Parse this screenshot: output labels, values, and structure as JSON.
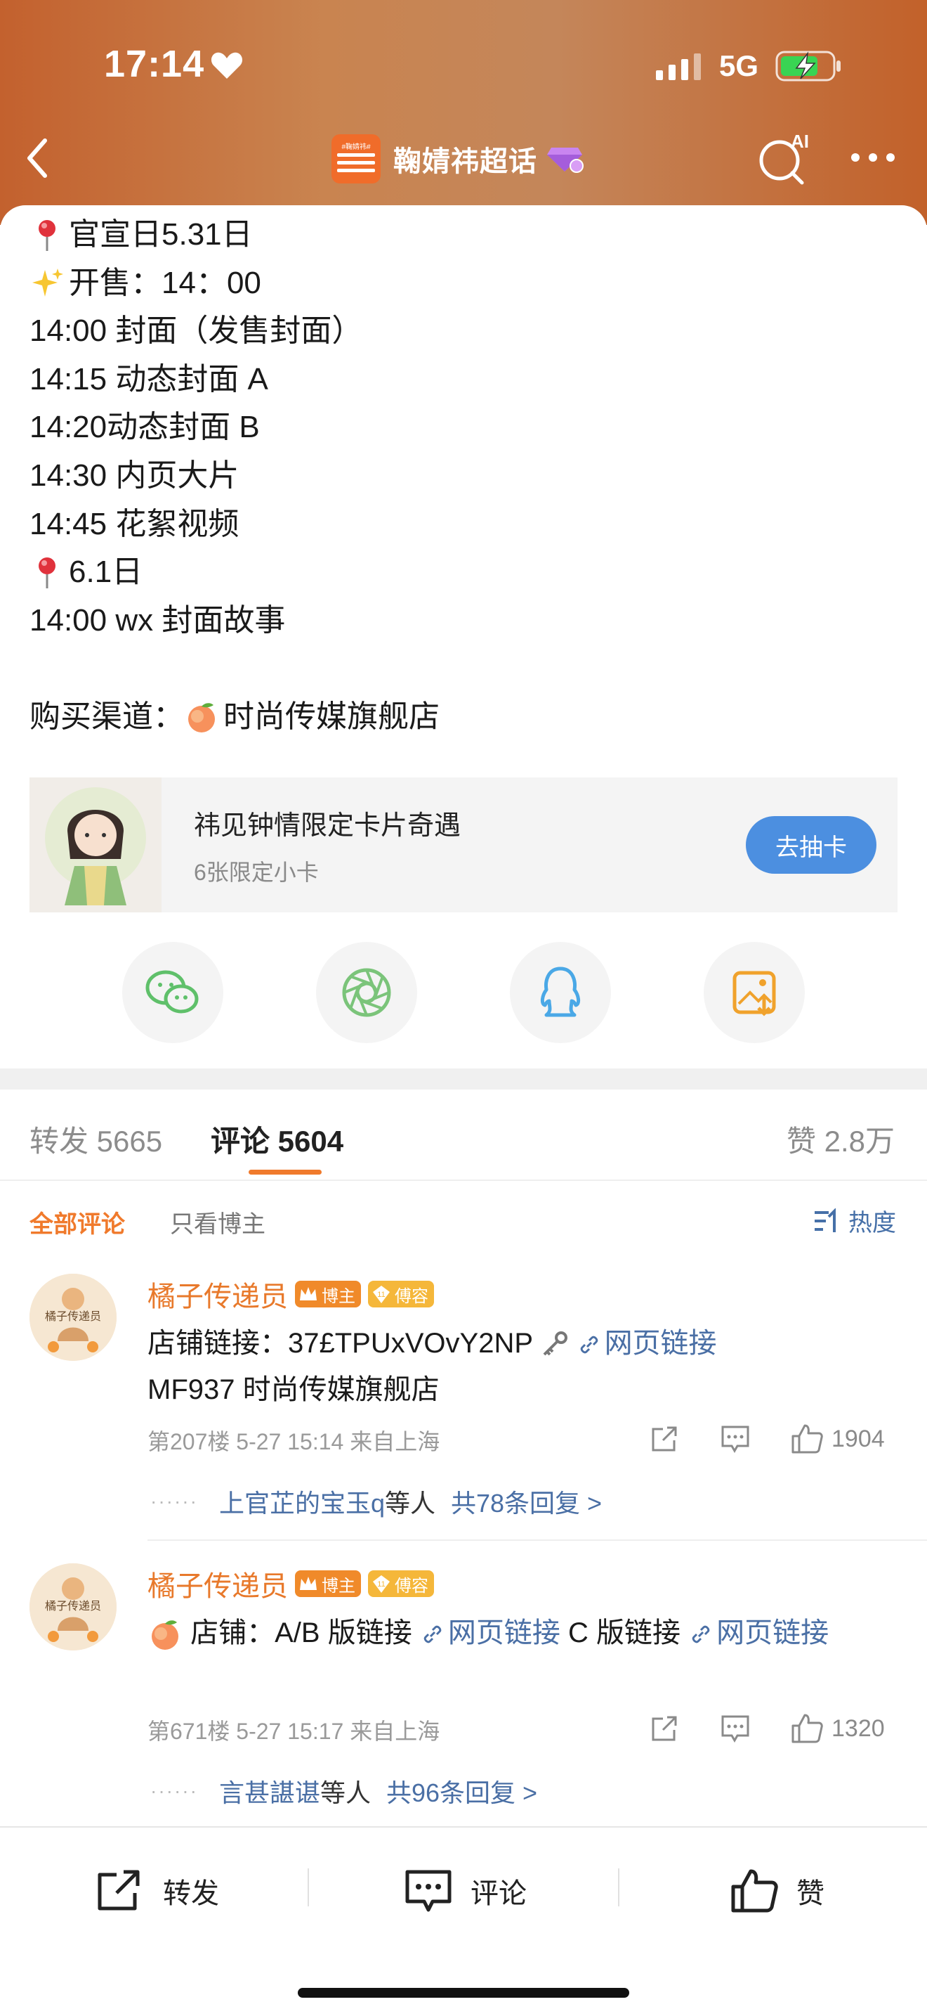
{
  "status": {
    "time": "17:14",
    "network": "5G"
  },
  "nav": {
    "title": "鞠婧祎超话",
    "logo_text": "#鞠婧祎#"
  },
  "post": {
    "lines": [
      {
        "emoji": "pin-icon",
        "text": "官宣日5.31日"
      },
      {
        "emoji": "sparkles-icon",
        "text": "开售：14：00"
      },
      {
        "emoji": "",
        "text": "14:00 封面（发售封面）"
      },
      {
        "emoji": "",
        "text": "14:15 动态封面 A"
      },
      {
        "emoji": "",
        "text": "14:20动态封面 B"
      },
      {
        "emoji": "",
        "text": "14:30 内页大片"
      },
      {
        "emoji": "",
        "text": "14:45 花絮视频"
      },
      {
        "emoji": "pin-icon",
        "text": "6.1日"
      },
      {
        "emoji": "",
        "text": "14:00 wx 封面故事"
      }
    ],
    "channel_label": "购买渠道：",
    "channel_name": "时尚传媒旗舰店"
  },
  "card": {
    "title": "祎见钟情限定卡片奇遇",
    "subtitle": "6张限定小卡",
    "button": "去抽卡"
  },
  "share": [
    "wechat-icon",
    "moments-icon",
    "qq-icon",
    "save-image-icon"
  ],
  "tabs": {
    "repost": "转发 5665",
    "comment": "评论 5604",
    "like": "赞 2.8万"
  },
  "filters": {
    "all": "全部评论",
    "host_only": "只看博主",
    "sort": "热度"
  },
  "comments": [
    {
      "name": "橘子传递员",
      "badge_host": "博主",
      "badge_honor": "傅容",
      "text_a": "店铺链接：37£TPUxVOvY2NP",
      "link": "网页链接",
      "text_b": "MF937 时尚传媒旗舰店",
      "meta": "第207楼 5-27 15:14 来自上海",
      "likes": "1904",
      "reply_user": "上官芷的宝玉q",
      "reply_mid": "等人",
      "reply_count": "共78条回复 >"
    },
    {
      "name": "橘子传递员",
      "badge_host": "博主",
      "badge_honor": "傅容",
      "text_a": "店铺：A/B 版链接",
      "link": "网页链接",
      "text_b": "C 版链接",
      "link2": "网页链接",
      "meta": "第671楼 5-27 15:17 来自上海",
      "likes": "1320",
      "reply_user": "言甚諶谌",
      "reply_mid": "等人",
      "reply_count": "共96条回复 >"
    }
  ],
  "bottom": {
    "repost": "转发",
    "comment": "评论",
    "like": "赞"
  }
}
